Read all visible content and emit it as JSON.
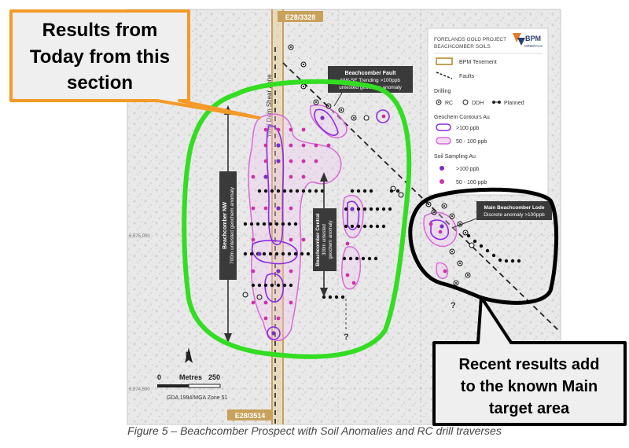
{
  "figure": {
    "caption": "Figure 5 – Beachcomber Prospect with Soil Anomalies and RC drill traverses"
  },
  "map": {
    "tenement_top_label": "E28/3328",
    "tenement_bottom_label": "E28/3514",
    "shear_zone_label": "Yindi Dam Shear Zone",
    "coord_top_a": "",
    "coord_left": "6,575,000",
    "coord_left_bottom": "6,574,500",
    "fault_label": {
      "line1": "Beachcomber Fault",
      "line2": "NW-SE Trending >100ppb",
      "line3": "untested geochem anomaly"
    },
    "nw_label": {
      "line1": "Beachcomber NW",
      "line2": "700m untested geochem anomaly"
    },
    "central_label": {
      "line1": "Beachcomber Central",
      "line2": "300m untested",
      "line3": "geochem anomaly"
    },
    "main_lode_label": {
      "line1": "Main Beachcomber Lode",
      "line2": "Discrete anomaly >100ppb"
    },
    "question_mark": "?",
    "north_letter": "N",
    "scale": {
      "start": "0",
      "unit": "Metres",
      "end": "250",
      "datum": "GDA 1994/MGA Zone 51"
    }
  },
  "legend": {
    "title_line1": "FORELANDS GOLD PROJECT",
    "title_line2": "BEACHCOMBER SOILS",
    "logo_line1": "BPM",
    "logo_line2": "MINERALS",
    "tenement": "BPM Tenement",
    "faults": "Faults",
    "drilling_heading": "Drilling",
    "rc": "RC",
    "ddh": "DDH",
    "planned": "Planned",
    "contours_heading": "Geochem Contours Au",
    "contour_high": ">100 ppb",
    "contour_mid": "50 - 100 ppb",
    "soil_heading": "Soil Sampling Au",
    "soil_high": ">100 ppb",
    "soil_mid": "50 - 100 ppb",
    "colors": {
      "tenement": "#c8a15a",
      "contour_high": "#8a2be2",
      "contour_mid": "#d86ad8",
      "soil_high": "#7b2fbf",
      "soil_mid": "#cc33aa"
    }
  },
  "callouts": {
    "today": {
      "line1": "Results from",
      "line2": "Today from this",
      "line3": "section",
      "border_color": "#f39a28"
    },
    "recent": {
      "line1": "Recent results add",
      "line2": "to the known Main",
      "line3": "target area",
      "border_color": "#000000"
    }
  },
  "annotation_colors": {
    "green_outline": "#33dd22",
    "black_outline": "#000000"
  }
}
